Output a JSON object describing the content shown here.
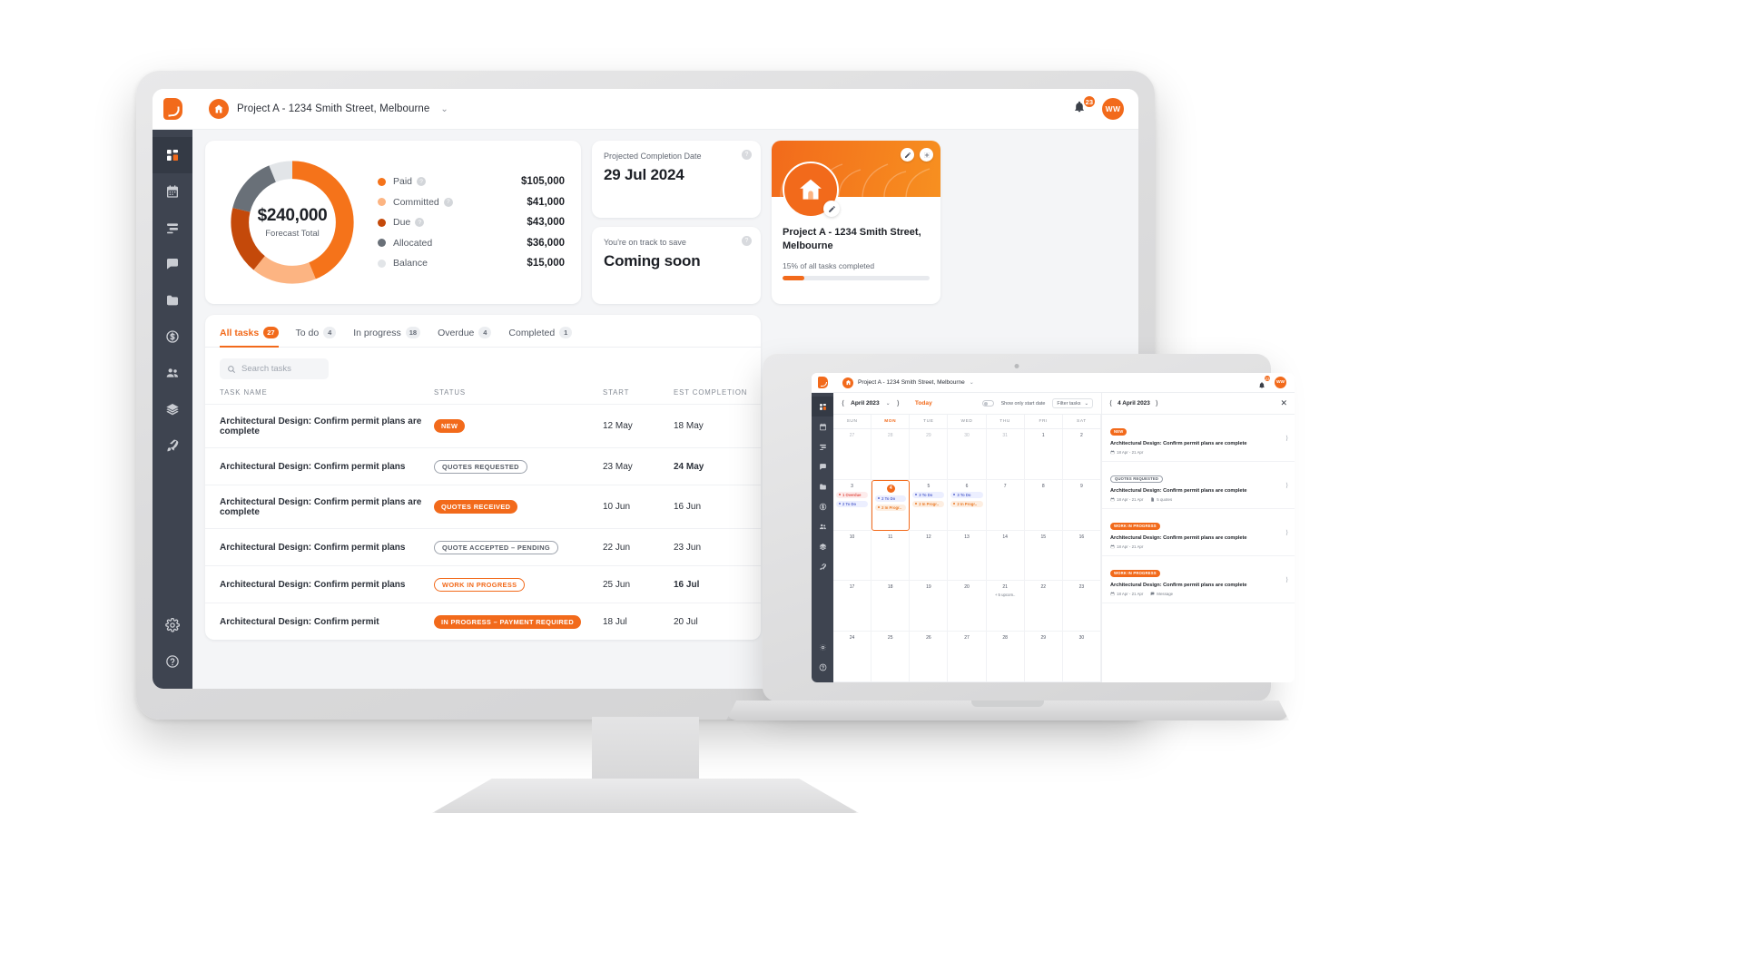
{
  "desktop": {
    "topbar": {
      "logo_icon": "brand-logo-icon",
      "home_icon": "home-icon",
      "project_title": "Project A - 1234 Smith Street, Melbourne",
      "chevron": "⌄",
      "bell_icon": "bell-icon",
      "notification_count": "23",
      "avatar_initials": "WW"
    },
    "sidebar": [
      {
        "name": "dashboard",
        "icon": "dashboard-icon",
        "active": true
      },
      {
        "name": "calendar",
        "icon": "calendar-icon",
        "active": false
      },
      {
        "name": "tasks",
        "icon": "tasks-icon",
        "active": false
      },
      {
        "name": "messages",
        "icon": "chat-icon",
        "active": false
      },
      {
        "name": "files",
        "icon": "folder-icon",
        "active": false
      },
      {
        "name": "finance",
        "icon": "dollar-icon",
        "active": false
      },
      {
        "name": "team",
        "icon": "people-icon",
        "active": false
      },
      {
        "name": "materials",
        "icon": "layers-icon",
        "active": false
      },
      {
        "name": "launch",
        "icon": "rocket-icon",
        "active": false
      },
      {
        "name": "settings",
        "icon": "gear-icon",
        "active": false
      },
      {
        "name": "help",
        "icon": "question-icon",
        "active": false
      }
    ],
    "finance": {
      "total": "$240,000",
      "total_label": "Forecast Total",
      "legend": [
        {
          "label": "Paid",
          "value": "$105,000",
          "color": "#f5731a",
          "help": "?"
        },
        {
          "label": "Committed",
          "value": "$41,000",
          "color": "#fcb482",
          "help": "?"
        },
        {
          "label": "Due",
          "value": "$43,000",
          "color": "#c4490a",
          "help": "?"
        },
        {
          "label": "Allocated",
          "value": "$36,000",
          "color": "#697078",
          "help": "?"
        },
        {
          "label": "Balance",
          "value": "$15,000",
          "color": "#e2e5e8",
          "help": "?"
        }
      ]
    },
    "completion_card": {
      "label": "Projected Completion Date",
      "value": "29 Jul 2024",
      "help": "?"
    },
    "savings_card": {
      "label": "You're on track to save",
      "value": "Coming soon",
      "help": "?"
    },
    "project_card": {
      "edit_icon": "pencil-icon",
      "settings_icon": "gear-icon",
      "avatar_icon": "home-icon",
      "avatar_edit_icon": "pencil-icon",
      "name": "Project A - 1234 Smith Street, Melbourne",
      "progress_label": "15% of all tasks completed",
      "progress_percent": 15
    },
    "tasks": {
      "tabs": [
        {
          "label": "All tasks",
          "count": "27",
          "active": true
        },
        {
          "label": "To do",
          "count": "4",
          "active": false
        },
        {
          "label": "In progress",
          "count": "18",
          "active": false
        },
        {
          "label": "Overdue",
          "count": "4",
          "active": false
        },
        {
          "label": "Completed",
          "count": "1",
          "active": false
        }
      ],
      "search_placeholder": "Search tasks",
      "search_icon": "search-icon",
      "columns": [
        "TASK NAME",
        "STATUS",
        "START",
        "EST COMPLETION"
      ],
      "rows": [
        {
          "name": "Architectural Design: Confirm permit plans are complete",
          "status": "NEW",
          "style": "solid",
          "start": "12 May",
          "est": "18 May",
          "est_overdue": false
        },
        {
          "name": "Architectural Design: Confirm permit plans",
          "status": "QUOTES REQUESTED",
          "style": "outline-grey",
          "start": "23 May",
          "est": "24 May",
          "est_overdue": true
        },
        {
          "name": "Architectural Design: Confirm permit plans are complete",
          "status": "QUOTES RECEIVED",
          "style": "solid",
          "start": "10 Jun",
          "est": "16 Jun",
          "est_overdue": false
        },
        {
          "name": "Architectural Design: Confirm permit plans",
          "status": "QUOTE ACCEPTED – PENDING",
          "style": "outline-grey",
          "start": "22 Jun",
          "est": "23 Jun",
          "est_overdue": false
        },
        {
          "name": "Architectural Design: Confirm permit plans",
          "status": "WORK IN PROGRESS",
          "style": "outline-orange",
          "start": "25 Jun",
          "est": "16 Jul",
          "est_overdue": true
        },
        {
          "name": "Architectural Design: Confirm permit",
          "status": "IN PROGRESS – PAYMENT REQUIRED",
          "style": "solid",
          "start": "18 Jul",
          "est": "20 Jul",
          "est_overdue": false
        }
      ]
    },
    "messages_tab": {
      "label": "Messages"
    }
  },
  "laptop": {
    "topbar": {
      "logo_icon": "brand-logo-icon",
      "home_icon": "home-icon",
      "project_title": "Project A - 1234 Smith Street, Melbourne",
      "bell_icon": "bell-icon",
      "notification_count": "23",
      "avatar_initials": "WW"
    },
    "sidebar": [
      {
        "name": "dashboard",
        "icon": "dashboard-icon",
        "active": true
      },
      {
        "name": "calendar",
        "icon": "calendar-icon",
        "active": false
      },
      {
        "name": "tasks",
        "icon": "tasks-icon",
        "active": false
      },
      {
        "name": "messages",
        "icon": "chat-icon",
        "active": false
      },
      {
        "name": "files",
        "icon": "folder-icon",
        "active": false
      },
      {
        "name": "finance",
        "icon": "dollar-icon",
        "active": false
      },
      {
        "name": "team",
        "icon": "people-icon",
        "active": false
      },
      {
        "name": "materials",
        "icon": "layers-icon",
        "active": false
      },
      {
        "name": "launch",
        "icon": "rocket-icon",
        "active": false
      },
      {
        "name": "settings",
        "icon": "gear-icon",
        "active": false
      },
      {
        "name": "help",
        "icon": "question-icon",
        "active": false
      }
    ],
    "calendar": {
      "prev_icon": "chevron-left-icon",
      "next_icon": "chevron-right-icon",
      "month": "April 2023",
      "today_label": "Today",
      "toggle_label": "Show only start date",
      "filter_label": "Filter tasks",
      "filter_chevron": "⌄",
      "dow": [
        "SUN",
        "MON",
        "TUE",
        "WED",
        "THU",
        "FRI",
        "SAT"
      ],
      "highlight_dow": "MON",
      "weeks": [
        [
          {
            "day": "27",
            "muted": true,
            "chips": []
          },
          {
            "day": "28",
            "muted": true,
            "chips": []
          },
          {
            "day": "29",
            "muted": true,
            "chips": []
          },
          {
            "day": "30",
            "muted": true,
            "chips": []
          },
          {
            "day": "31",
            "muted": true,
            "chips": []
          },
          {
            "day": "1",
            "muted": false,
            "chips": []
          },
          {
            "day": "2",
            "muted": false,
            "chips": []
          }
        ],
        [
          {
            "day": "3",
            "muted": false,
            "chips": [
              {
                "text": "1 Overdue",
                "tone": "chip-red"
              },
              {
                "text": "2 To Do",
                "tone": "chip-blue"
              }
            ]
          },
          {
            "day": "4",
            "muted": false,
            "today": true,
            "selected": true,
            "chips": [
              {
                "text": "2 To Do",
                "tone": "chip-blue"
              },
              {
                "text": "2 In Progr..",
                "tone": "chip-orange"
              }
            ]
          },
          {
            "day": "5",
            "muted": false,
            "chips": [
              {
                "text": "3 To Do",
                "tone": "chip-blue"
              },
              {
                "text": "2 In Progr..",
                "tone": "chip-orange"
              }
            ]
          },
          {
            "day": "6",
            "muted": false,
            "chips": [
              {
                "text": "3 To Do",
                "tone": "chip-blue"
              },
              {
                "text": "2 In Progr..",
                "tone": "chip-orange"
              }
            ]
          },
          {
            "day": "7",
            "muted": false,
            "chips": []
          },
          {
            "day": "8",
            "muted": false,
            "chips": []
          },
          {
            "day": "9",
            "muted": false,
            "chips": []
          }
        ],
        [
          {
            "day": "10",
            "muted": false,
            "chips": []
          },
          {
            "day": "11",
            "muted": false,
            "chips": []
          },
          {
            "day": "12",
            "muted": false,
            "chips": []
          },
          {
            "day": "13",
            "muted": false,
            "chips": []
          },
          {
            "day": "14",
            "muted": false,
            "chips": []
          },
          {
            "day": "15",
            "muted": false,
            "chips": []
          },
          {
            "day": "16",
            "muted": false,
            "chips": []
          }
        ],
        [
          {
            "day": "17",
            "muted": false,
            "chips": []
          },
          {
            "day": "18",
            "muted": false,
            "chips": []
          },
          {
            "day": "19",
            "muted": false,
            "chips": []
          },
          {
            "day": "20",
            "muted": false,
            "chips": []
          },
          {
            "day": "21",
            "muted": false,
            "more": "+ 5 upcom..",
            "chips": []
          },
          {
            "day": "22",
            "muted": false,
            "chips": []
          },
          {
            "day": "23",
            "muted": false,
            "chips": []
          }
        ],
        [
          {
            "day": "24",
            "muted": false,
            "chips": []
          },
          {
            "day": "25",
            "muted": false,
            "chips": []
          },
          {
            "day": "26",
            "muted": false,
            "chips": []
          },
          {
            "day": "27",
            "muted": false,
            "chips": []
          },
          {
            "day": "28",
            "muted": false,
            "chips": []
          },
          {
            "day": "29",
            "muted": false,
            "chips": []
          },
          {
            "day": "30",
            "muted": false,
            "chips": []
          }
        ]
      ]
    },
    "day_panel": {
      "prev_icon": "chevron-left-icon",
      "next_icon": "chevron-right-icon",
      "date": "4 April 2023",
      "close_icon": "close-icon",
      "items": [
        {
          "status": "NEW",
          "style": "solid",
          "title": "Architectural Design: Confirm permit plans are complete",
          "dates": "18 Apr - 21 Apr",
          "extra": ""
        },
        {
          "status": "QUOTES REQUESTED",
          "style": "outline-grey",
          "title": "Architectural Design: Confirm permit plans are complete",
          "dates": "18 Apr - 21 Apr",
          "extra": "5 quotes"
        },
        {
          "status": "WORK IN PROGRESS",
          "style": "solid",
          "title": "Architectural Design: Confirm permit plans are complete",
          "dates": "18 Apr - 21 Apr",
          "extra": ""
        },
        {
          "status": "WORK IN PROGRESS",
          "style": "solid",
          "title": "Architectural Design: Confirm permit plans are complete",
          "dates": "18 Apr - 21 Apr",
          "extra": "Message"
        }
      ]
    }
  },
  "chart_data": {
    "type": "pie",
    "title": "Forecast Total",
    "center_value": "$240,000",
    "total": 240000,
    "labels": [
      "Paid",
      "Committed",
      "Due",
      "Allocated",
      "Balance"
    ],
    "values": [
      105000,
      41000,
      43000,
      36000,
      15000
    ],
    "display_values": [
      "$105,000",
      "$41,000",
      "$43,000",
      "$36,000",
      "$15,000"
    ],
    "colors": [
      "#f5731a",
      "#fcb482",
      "#c4490a",
      "#697078",
      "#e2e5e8"
    ],
    "legend_position": "right",
    "donut": true
  }
}
